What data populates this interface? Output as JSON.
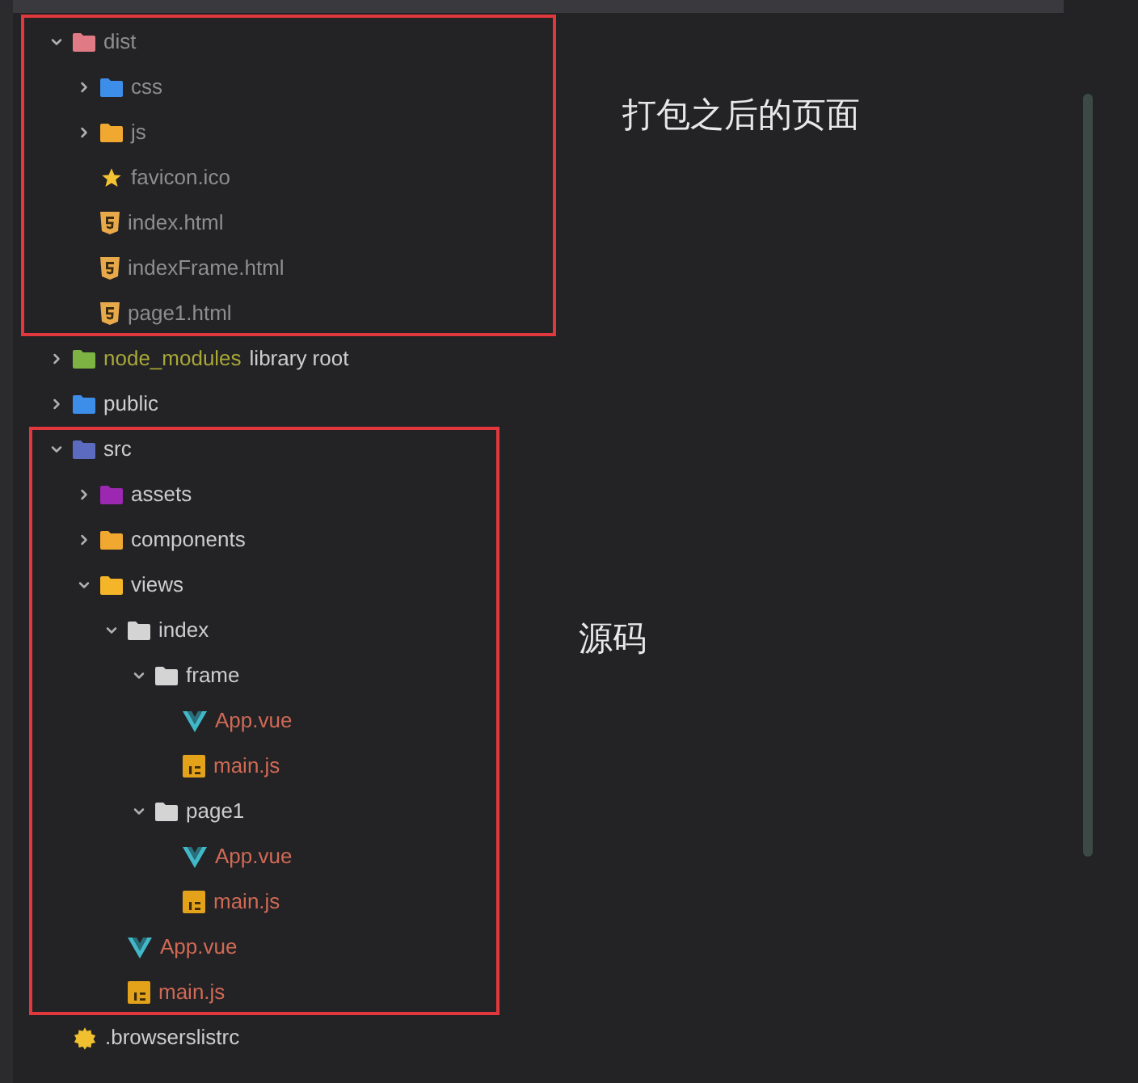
{
  "tree": [
    {
      "name": "dist",
      "kind": "folder",
      "icon": {
        "color": "#e07b85"
      },
      "color": "#8e8e8e",
      "expanded": true,
      "annotation": "打包之后的页面",
      "children": [
        {
          "name": "css",
          "kind": "folder",
          "icon": {
            "color": "#3d8ee8"
          },
          "color": "#8e8e8e",
          "expanded": false
        },
        {
          "name": "js",
          "kind": "folder",
          "icon": {
            "color": "#f0a830"
          },
          "color": "#8e8e8e",
          "expanded": false
        },
        {
          "name": "favicon.ico",
          "kind": "file-star",
          "color": "#8e8e8e"
        },
        {
          "name": "index.html",
          "kind": "file-html",
          "color": "#8e8e8e"
        },
        {
          "name": "indexFrame.html",
          "kind": "file-html",
          "color": "#8e8e8e"
        },
        {
          "name": "page1.html",
          "kind": "file-html",
          "color": "#8e8e8e"
        }
      ]
    },
    {
      "name": "node_modules",
      "suffix": "library root",
      "kind": "folder",
      "icon": {
        "color": "#7cb342"
      },
      "color": "#a8a838",
      "expanded": false
    },
    {
      "name": "public",
      "kind": "folder",
      "icon": {
        "color": "#3d8ee8"
      },
      "color": "#cdcdcd",
      "expanded": false
    },
    {
      "name": "src",
      "kind": "folder",
      "icon": {
        "color": "#5c6bc0"
      },
      "color": "#cdcdcd",
      "expanded": true,
      "annotation": "源码",
      "children": [
        {
          "name": "assets",
          "kind": "folder",
          "icon": {
            "color": "#9c27b0"
          },
          "color": "#cdcdcd",
          "expanded": false
        },
        {
          "name": "components",
          "kind": "folder",
          "icon": {
            "color": "#f0a830"
          },
          "color": "#cdcdcd",
          "expanded": false
        },
        {
          "name": "views",
          "kind": "folder",
          "icon": {
            "color": "#f5b528"
          },
          "color": "#cdcdcd",
          "expanded": true,
          "children": [
            {
              "name": "index",
              "kind": "folder",
              "icon": {
                "color": "#d4d4d4"
              },
              "color": "#cdcdcd",
              "expanded": true,
              "children": [
                {
                  "name": "frame",
                  "kind": "folder",
                  "icon": {
                    "color": "#d4d4d4"
                  },
                  "color": "#cdcdcd",
                  "expanded": true,
                  "children": [
                    {
                      "name": "App.vue",
                      "kind": "file-vue",
                      "color": "#d06a55"
                    },
                    {
                      "name": "main.js",
                      "kind": "file-js",
                      "color": "#d06a55"
                    }
                  ]
                },
                {
                  "name": "page1",
                  "kind": "folder",
                  "icon": {
                    "color": "#d4d4d4"
                  },
                  "color": "#cdcdcd",
                  "expanded": true,
                  "children": [
                    {
                      "name": "App.vue",
                      "kind": "file-vue",
                      "color": "#d06a55"
                    },
                    {
                      "name": "main.js",
                      "kind": "file-js",
                      "color": "#d06a55"
                    }
                  ]
                }
              ]
            },
            {
              "name": "App.vue",
              "kind": "file-vue",
              "color": "#d06a55"
            },
            {
              "name": "main.js",
              "kind": "file-js",
              "color": "#d06a55"
            }
          ]
        }
      ]
    },
    {
      "name": ".browserslistrc",
      "kind": "file-config",
      "color": "#cdcdcd"
    }
  ]
}
